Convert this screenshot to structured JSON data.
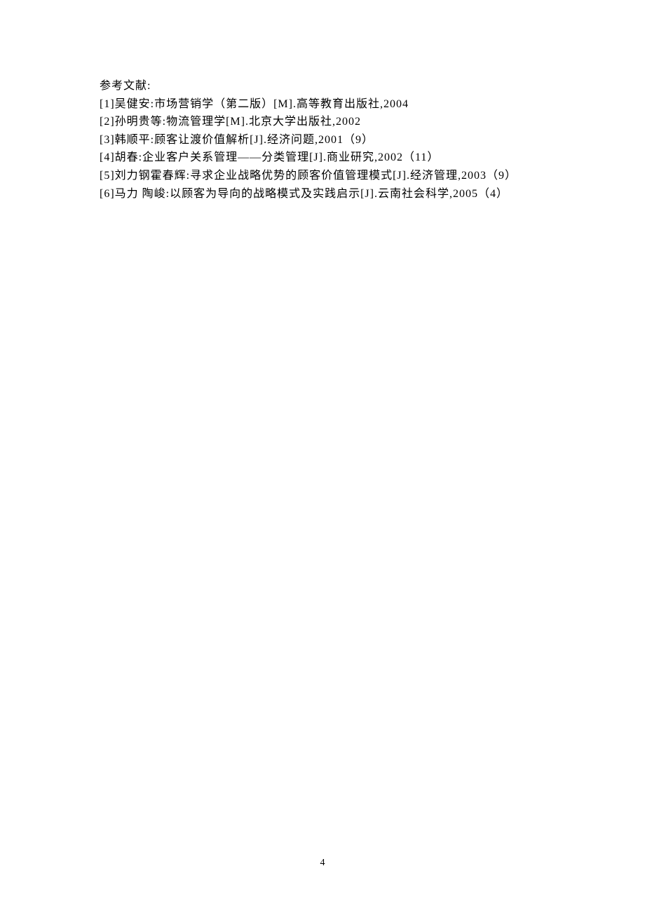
{
  "heading": "参考文献:",
  "references": [
    "[1]吴健安:市场营销学（第二版）[M].高等教育出版社,2004",
    "[2]孙明贵等:物流管理学[M].北京大学出版社,2002",
    "[3]韩顺平:顾客让渡价值解析[J].经济问题,2001（9）",
    "[4]胡春:企业客户关系管理——分类管理[J].商业研究,2002（11）",
    "[5]刘力钢霍春辉:寻求企业战略优势的顾客价值管理模式[J].经济管理,2003（9）",
    "[6]马力 陶峻:以顾客为导向的战略模式及实践启示[J].云南社会科学,2005（4）"
  ],
  "page_number": "4"
}
